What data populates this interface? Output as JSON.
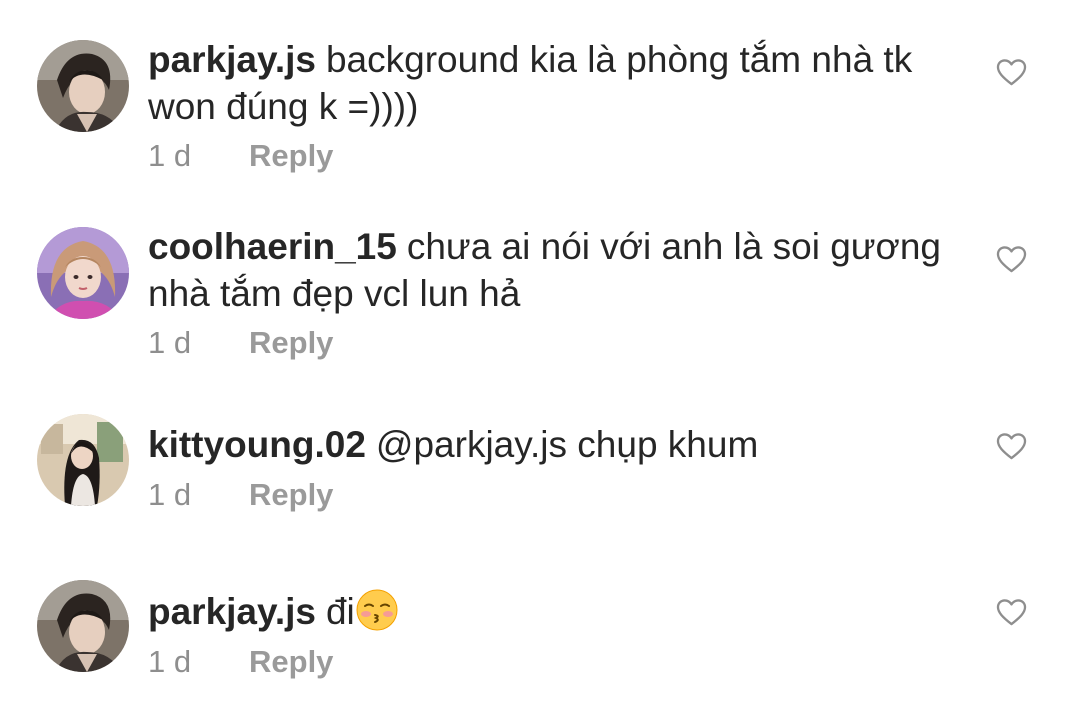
{
  "comments": [
    {
      "username": "parkjay.js",
      "text": "background kia là phòng tắm nhà tk won đúng k =))))",
      "time": "1 d",
      "reply_label": "Reply",
      "avatar_icon": "profile-photo-dark-haired-man",
      "like_icon": "heart-outline-icon"
    },
    {
      "username": "coolhaerin_15",
      "text": "chưa ai nói với anh là soi gương nhà tắm đẹp vcl lun hả",
      "time": "1 d",
      "reply_label": "Reply",
      "avatar_icon": "profile-photo-girl-pink",
      "like_icon": "heart-outline-icon"
    },
    {
      "username": "kittyoung.02",
      "text": "@parkjay.js chụp khum",
      "time": "1 d",
      "reply_label": "Reply",
      "avatar_icon": "profile-photo-girl-room",
      "like_icon": "heart-outline-icon"
    },
    {
      "username": "parkjay.js",
      "text": "đi",
      "emoji": "kissing-face-with-closed-eyes",
      "time": "1 d",
      "reply_label": "Reply",
      "avatar_icon": "profile-photo-dark-haired-man",
      "like_icon": "heart-outline-icon"
    }
  ],
  "colors": {
    "text": "#262626",
    "meta": "#8e8e8e",
    "heart_stroke": "#8e8e8e"
  }
}
